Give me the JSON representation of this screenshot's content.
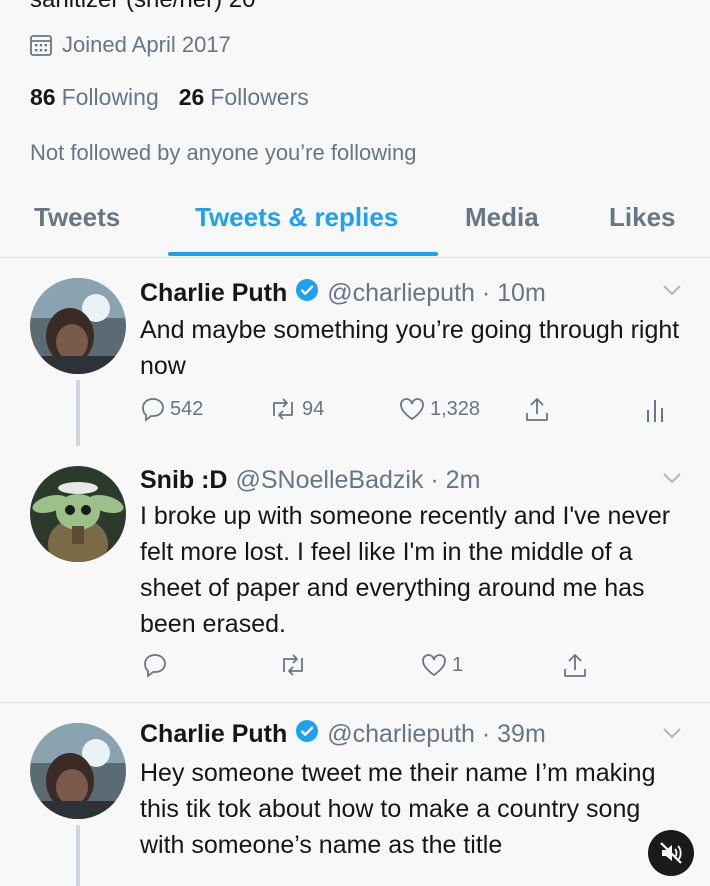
{
  "profile": {
    "bio_cut": "sanitizer (she/her) 20",
    "joined": "Joined April 2017",
    "following_count": "86",
    "following_label": "Following",
    "followers_count": "26",
    "followers_label": "Followers",
    "not_followed": "Not followed by anyone you’re following"
  },
  "tabs": [
    {
      "label": "Tweets",
      "active": false
    },
    {
      "label": "Tweets & replies",
      "active": true
    },
    {
      "label": "Media",
      "active": false
    },
    {
      "label": "Likes",
      "active": false
    }
  ],
  "tweets": [
    {
      "name": "Charlie Puth",
      "verified": true,
      "handle": "@charlieputh · 10m",
      "text": "And maybe something you’re going through right now",
      "replies": "542",
      "retweets": "94",
      "likes": "1,328"
    },
    {
      "name": "Snib :D",
      "verified": false,
      "handle": "@SNoelleBadzik · 2m",
      "text": "I broke up with someone recently and I've never felt more lost. I feel like I'm in the middle of a sheet of paper and everything around me has been erased.",
      "replies": "",
      "retweets": "",
      "likes": "1"
    },
    {
      "name": "Charlie Puth",
      "verified": true,
      "handle": "@charlieputh · 39m",
      "text": "Hey someone tweet me their name I’m making this tik tok about how to make a country song with someone’s name as the title"
    }
  ],
  "colors": {
    "accent": "#1da1f2",
    "secondary_text": "#657786",
    "background": "#f7f8f7"
  }
}
